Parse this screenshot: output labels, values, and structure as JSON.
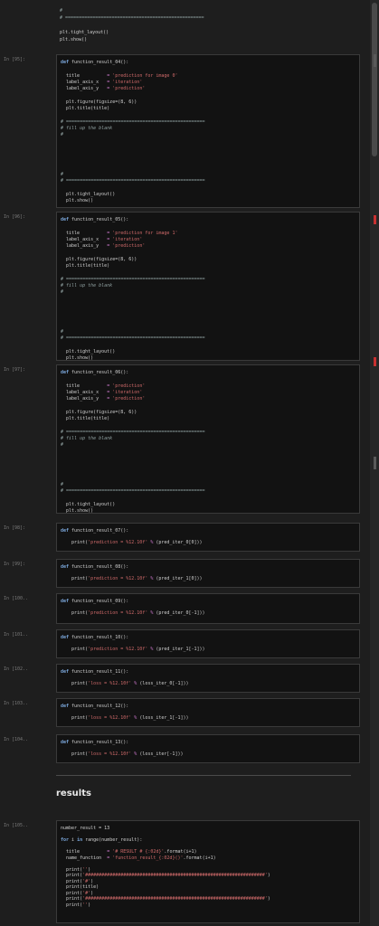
{
  "cells": [
    {
      "id": "c0",
      "prompt": "",
      "plain": true,
      "lines": [
        [
          [
            "cmt",
            "#"
          ]
        ],
        [
          [
            "cmt",
            "# ==================================================="
          ]
        ],
        [],
        [
          [
            "fn",
            "plt.tight_layout()"
          ]
        ],
        [
          [
            "fn",
            "plt.show()"
          ]
        ]
      ]
    },
    {
      "id": "c95",
      "prompt": "In [95]:",
      "lines": [
        [
          [
            "kw",
            "def "
          ],
          [
            "fn",
            "function_result_04():"
          ]
        ],
        [],
        [
          [
            "fn",
            "  title          "
          ],
          [
            "op",
            "= "
          ],
          [
            "str",
            "'prediction for image 0'"
          ]
        ],
        [
          [
            "fn",
            "  label_axis_x   "
          ],
          [
            "op",
            "= "
          ],
          [
            "str",
            "'iteration'"
          ]
        ],
        [
          [
            "fn",
            "  label_axis_y   "
          ],
          [
            "op",
            "= "
          ],
          [
            "str",
            "'prediction'"
          ]
        ],
        [],
        [
          [
            "fn",
            "  plt.figure(figsize=(8, 6))"
          ]
        ],
        [
          [
            "fn",
            "  plt.title(title)"
          ]
        ],
        [],
        [
          [
            "cmt",
            "# ==================================================="
          ]
        ],
        [
          [
            "cmt",
            "# fill up the blank"
          ]
        ],
        [
          [
            "cmt",
            "#"
          ]
        ],
        [],
        [],
        [],
        [],
        [],
        [
          [
            "cmt",
            "#"
          ]
        ],
        [
          [
            "cmt",
            "# ==================================================="
          ]
        ],
        [],
        [
          [
            "fn",
            "  plt.tight_layout()"
          ]
        ],
        [
          [
            "fn",
            "  plt.show()"
          ]
        ]
      ]
    },
    {
      "id": "c96",
      "prompt": "In [96]:",
      "lines": [
        [
          [
            "kw",
            "def "
          ],
          [
            "fn",
            "function_result_05():"
          ]
        ],
        [],
        [
          [
            "fn",
            "  title          "
          ],
          [
            "op",
            "= "
          ],
          [
            "str",
            "'prediction for image 1'"
          ]
        ],
        [
          [
            "fn",
            "  label_axis_x   "
          ],
          [
            "op",
            "= "
          ],
          [
            "str",
            "'iteration'"
          ]
        ],
        [
          [
            "fn",
            "  label_axis_y   "
          ],
          [
            "op",
            "= "
          ],
          [
            "str",
            "'prediction'"
          ]
        ],
        [],
        [
          [
            "fn",
            "  plt.figure(figsize=(8, 6))"
          ]
        ],
        [
          [
            "fn",
            "  plt.title(title)"
          ]
        ],
        [],
        [
          [
            "cmt",
            "# ==================================================="
          ]
        ],
        [
          [
            "cmt",
            "# fill up the blank"
          ]
        ],
        [
          [
            "cmt",
            "#"
          ]
        ],
        [],
        [],
        [],
        [],
        [],
        [
          [
            "cmt",
            "#"
          ]
        ],
        [
          [
            "cmt",
            "# ==================================================="
          ]
        ],
        [],
        [
          [
            "fn",
            "  plt.tight_layout()"
          ]
        ],
        [
          [
            "fn",
            "  plt.show()"
          ]
        ]
      ]
    },
    {
      "id": "c97",
      "prompt": "In [97]:",
      "lines": [
        [
          [
            "kw",
            "def "
          ],
          [
            "fn",
            "function_result_06():"
          ]
        ],
        [],
        [
          [
            "fn",
            "  title          "
          ],
          [
            "op",
            "= "
          ],
          [
            "str",
            "'prediction'"
          ]
        ],
        [
          [
            "fn",
            "  label_axis_x   "
          ],
          [
            "op",
            "= "
          ],
          [
            "str",
            "'iteration'"
          ]
        ],
        [
          [
            "fn",
            "  label_axis_y   "
          ],
          [
            "op",
            "= "
          ],
          [
            "str",
            "'prediction'"
          ]
        ],
        [],
        [
          [
            "fn",
            "  plt.figure(figsize=(8, 6))"
          ]
        ],
        [
          [
            "fn",
            "  plt.title(title)"
          ]
        ],
        [],
        [
          [
            "cmt",
            "# ==================================================="
          ]
        ],
        [
          [
            "cmt",
            "# fill up the blank"
          ]
        ],
        [
          [
            "cmt",
            "#"
          ]
        ],
        [],
        [],
        [],
        [],
        [],
        [
          [
            "cmt",
            "#"
          ]
        ],
        [
          [
            "cmt",
            "# ==================================================="
          ]
        ],
        [],
        [
          [
            "fn",
            "  plt.tight_layout()"
          ]
        ],
        [
          [
            "fn",
            "  plt.show()"
          ]
        ]
      ]
    },
    {
      "id": "c98",
      "prompt": "In [98]:",
      "lines": [
        [
          [
            "kw",
            "def "
          ],
          [
            "fn",
            "function_result_07():"
          ]
        ],
        [],
        [
          [
            "fn",
            "    print("
          ],
          [
            "str",
            "'prediction = %12.10f'"
          ],
          [
            "op",
            " % "
          ],
          [
            "fn",
            "(pred_iter_0[0]))"
          ]
        ]
      ]
    },
    {
      "id": "c99",
      "prompt": "In [99]:",
      "lines": [
        [
          [
            "kw",
            "def "
          ],
          [
            "fn",
            "function_result_08():"
          ]
        ],
        [],
        [
          [
            "fn",
            "    print("
          ],
          [
            "str",
            "'prediction = %12.10f'"
          ],
          [
            "op",
            " % "
          ],
          [
            "fn",
            "(pred_iter_1[0]))"
          ]
        ]
      ]
    },
    {
      "id": "c100",
      "prompt": "In [100..",
      "lines": [
        [
          [
            "kw",
            "def "
          ],
          [
            "fn",
            "function_result_09():"
          ]
        ],
        [],
        [
          [
            "fn",
            "    print("
          ],
          [
            "str",
            "'prediction = %12.10f'"
          ],
          [
            "op",
            " % "
          ],
          [
            "fn",
            "(pred_iter_0[-1]))"
          ]
        ]
      ]
    },
    {
      "id": "c101",
      "prompt": "In [101..",
      "lines": [
        [
          [
            "kw",
            "def "
          ],
          [
            "fn",
            "function_result_10():"
          ]
        ],
        [],
        [
          [
            "fn",
            "    print("
          ],
          [
            "str",
            "'prediction = %12.10f'"
          ],
          [
            "op",
            " % "
          ],
          [
            "fn",
            "(pred_iter_1[-1]))"
          ]
        ]
      ]
    },
    {
      "id": "c102",
      "prompt": "In [102..",
      "lines": [
        [
          [
            "kw",
            "def "
          ],
          [
            "fn",
            "function_result_11():"
          ]
        ],
        [],
        [
          [
            "fn",
            "    print("
          ],
          [
            "str",
            "'loss = %12.10f'"
          ],
          [
            "op",
            " % "
          ],
          [
            "fn",
            "(loss_iter_0[-1]))"
          ]
        ]
      ]
    },
    {
      "id": "c103",
      "prompt": "In [103..",
      "lines": [
        [
          [
            "kw",
            "def "
          ],
          [
            "fn",
            "function_result_12():"
          ]
        ],
        [],
        [
          [
            "fn",
            "    print("
          ],
          [
            "str",
            "'loss = %12.10f'"
          ],
          [
            "op",
            " % "
          ],
          [
            "fn",
            "(loss_iter_1[-1]))"
          ]
        ]
      ]
    },
    {
      "id": "c104",
      "prompt": "In [104..",
      "lines": [
        [
          [
            "kw",
            "def "
          ],
          [
            "fn",
            "function_result_13():"
          ]
        ],
        [],
        [
          [
            "fn",
            "    print("
          ],
          [
            "str",
            "'loss = %12.10f'"
          ],
          [
            "op",
            " % "
          ],
          [
            "fn",
            "(loss_iter[-1]))"
          ]
        ]
      ]
    },
    {
      "id": "c105",
      "prompt": "In [105..",
      "lines": [
        [
          [
            "fn",
            "number_result = 13"
          ]
        ],
        [],
        [
          [
            "kw",
            "for "
          ],
          [
            "fn",
            "i "
          ],
          [
            "kw",
            "in "
          ],
          [
            "fn",
            "range(number_result):"
          ]
        ],
        [],
        [
          [
            "fn",
            "  title          "
          ],
          [
            "op",
            "= "
          ],
          [
            "str",
            "'# RESULT # {:02d}'"
          ],
          [
            "fn",
            ".format(i+1)"
          ]
        ],
        [
          [
            "fn",
            "  name_function  "
          ],
          [
            "op",
            "= "
          ],
          [
            "str",
            "'function_result_{:02d}()'"
          ],
          [
            "fn",
            ".format(i+1)"
          ]
        ],
        [],
        [
          [
            "fn",
            "  print("
          ],
          [
            "str",
            "''"
          ],
          [
            "fn",
            ")"
          ]
        ],
        [
          [
            "fn",
            "  print("
          ],
          [
            "str",
            "'##################################################################'"
          ],
          [
            "fn",
            ")"
          ]
        ],
        [
          [
            "fn",
            "  print("
          ],
          [
            "str",
            "'#'"
          ],
          [
            "fn",
            ")"
          ]
        ],
        [
          [
            "fn",
            "  print(title)"
          ]
        ],
        [
          [
            "fn",
            "  print("
          ],
          [
            "str",
            "'#'"
          ],
          [
            "fn",
            ")"
          ]
        ],
        [
          [
            "fn",
            "  print("
          ],
          [
            "str",
            "'##################################################################'"
          ],
          [
            "fn",
            ")"
          ]
        ],
        [
          [
            "fn",
            "  print("
          ],
          [
            "str",
            "''"
          ],
          [
            "fn",
            ")"
          ]
        ]
      ]
    }
  ],
  "results_heading": "results"
}
